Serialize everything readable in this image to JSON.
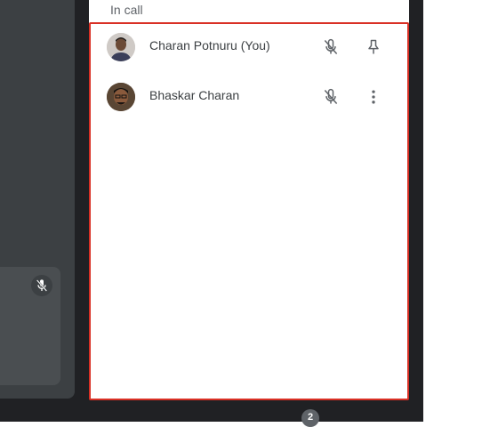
{
  "panel": {
    "section_title": "In call",
    "participants": [
      {
        "name": "Charan Potnuru (You)",
        "muted": true,
        "action": "pin-icon"
      },
      {
        "name": "Bhaskar Charan",
        "muted": true,
        "action": "more-vert-icon"
      }
    ]
  },
  "footer": {
    "participant_count": "2"
  },
  "colors": {
    "highlight_border": "#d93025",
    "background_dark": "#202124",
    "text": "#3c4043"
  }
}
